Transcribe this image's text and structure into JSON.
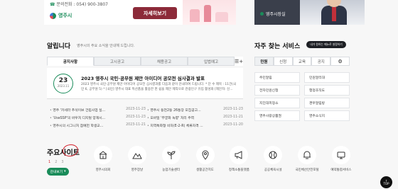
{
  "header": {
    "phone_label": "문의전화 : 054) 900-3807",
    "city_name": "영주시",
    "more_button": "자세히보기",
    "mayor_link": "영주시장실"
  },
  "notices": {
    "title": "알립니다",
    "subtitle": "영주시의 주요 소식을 안내해 드립니다.",
    "tabs": [
      "공지사항",
      "고시공고",
      "채용공고",
      "입법예고"
    ],
    "more_symbol": "☰+",
    "feature": {
      "day": "23",
      "year_month": "2023.11",
      "title": "2023 영주시 국민·공무원 제안 아이디어 공모전 심사결과 발표",
      "body": "2023 영주시 국민·공무원 제안 아이디어 공모전 심사결과를 다음과 같이 안내하여 드립니다. * 단 수 제목 : 11건(국민 6, 공무원 5) * [국민] 영주시 대표 특산품을 활용한 펀 쉽을 제안 제작으로 관광인구 유입 활성화 [제안자: 신..."
    },
    "list_left": [
      {
        "title": "영주 '카세라 추석이브 건립사업 실...",
        "date": "2023-11-23"
      },
      {
        "title": "'UseSSP'의 바우처 디지털 양재시...",
        "date": "2023-11-23"
      },
      {
        "title": "영주시의 시그니처 참예헌 학생교...",
        "date": "2023-11-21"
      }
    ],
    "list_right": [
      {
        "title": "영주시 동천2동 26통장 모집공고...",
        "date": "2023-11-23"
      },
      {
        "title": "모바일 '무궁화 녹향' 처리 주역",
        "date": "2023-11-21"
      },
      {
        "title": "지역특화형 비자(E-2-R) 체류자격 ...",
        "date": "2023-11-20"
      }
    ]
  },
  "services": {
    "title": "자주 찾는 서비스",
    "badge": "내가 원하는 메뉴로 설정하기",
    "tabs": [
      "민원",
      "신청",
      "교육",
      "공지"
    ],
    "items": [
      "주민알림",
      "민원알리대",
      "전자민원신청",
      "행정조직도",
      "지진대피정소",
      "경우알림방",
      "영주사랑상품권",
      "영주소식지"
    ]
  },
  "main_sites": {
    "title": "주요사이트",
    "pager": [
      "1",
      "2",
      "3"
    ],
    "region_button": "관내보기",
    "region_caret": "▾",
    "sites": [
      {
        "label": "영주시의회",
        "icon": "building-icon"
      },
      {
        "label": "영주장날",
        "icon": "mountain-icon"
      },
      {
        "label": "농업기술센터",
        "icon": "sprout-icon"
      },
      {
        "label": "생활공간지도",
        "icon": "map-pin-icon"
      },
      {
        "label": "정책소통플랫폼",
        "icon": "megaphone-icon"
      },
      {
        "label": "공공체육시설",
        "icon": "ball-icon"
      },
      {
        "label": "국민체산안전포털",
        "icon": "bell-icon"
      },
      {
        "label": "예약통합서비스",
        "icon": "monitor-icon"
      }
    ]
  },
  "top_button": {
    "arrow": "↑",
    "label": "TOP"
  },
  "colors": {
    "accent_green": "#1a8c5a",
    "button_maroon": "#8c2a39",
    "scribble_red": "#d31f2b"
  }
}
